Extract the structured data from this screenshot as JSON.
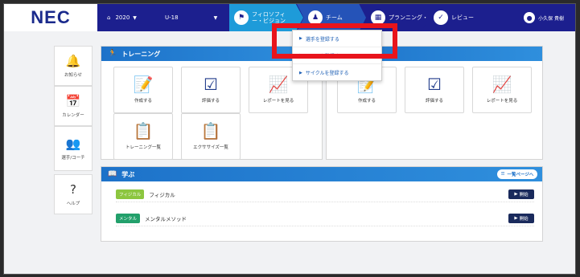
{
  "header": {
    "logo": "NEC",
    "year": "2020",
    "category": "U-18",
    "tabs": [
      {
        "label": "フィロソフィー・ビジョン",
        "icon": "flag-icon"
      },
      {
        "label": "チーム",
        "icon": "team-icon"
      },
      {
        "label": "プランニング・",
        "icon": "calendar-icon"
      },
      {
        "label": "レビュー",
        "icon": "check-icon"
      }
    ],
    "user": "小久保 貴樹"
  },
  "sidebar": [
    {
      "label": "お知らせ",
      "icon": "bell-icon",
      "glyph": "🔔"
    },
    {
      "label": "カレンダー",
      "icon": "calendar-icon",
      "glyph": "📅"
    },
    {
      "label": "選手/コーチ",
      "icon": "people-icon",
      "glyph": "👥"
    },
    {
      "label": "ヘルプ",
      "icon": "help-icon",
      "glyph": "?"
    }
  ],
  "training": {
    "title": "トレーニング",
    "cards": [
      {
        "label": "作成する",
        "glyph": "📝"
      },
      {
        "label": "評価する",
        "glyph": "☑"
      },
      {
        "label": "レポートを見る",
        "glyph": "📈"
      },
      {
        "label": "トレーニング一覧",
        "glyph": "📋"
      },
      {
        "label": "エクササイズ一覧",
        "glyph": "📋"
      }
    ]
  },
  "training2": {
    "cards": [
      {
        "label": "作成する",
        "glyph": "📝"
      },
      {
        "label": "評価する",
        "glyph": "☑"
      },
      {
        "label": "レポートを見る",
        "glyph": "📈"
      }
    ]
  },
  "manabu": {
    "title": "学ぶ",
    "all_pages": "一覧ページへ",
    "rows": [
      {
        "badge": "フィジカル",
        "label": "フィジカル",
        "badge_color": "#8cc63f",
        "button": "開始"
      },
      {
        "badge": "メンタル",
        "label": "メンタルメソッド",
        "badge_color": "#22a06b",
        "button": "開始"
      }
    ]
  },
  "dropdown": {
    "items": [
      "選手を登録する",
      "コーチを登録する",
      "サイクルを登録する"
    ]
  },
  "colors": {
    "nav": "#1c1f8e",
    "accent": "#1e9bd9",
    "highlight": "#e8141c"
  }
}
